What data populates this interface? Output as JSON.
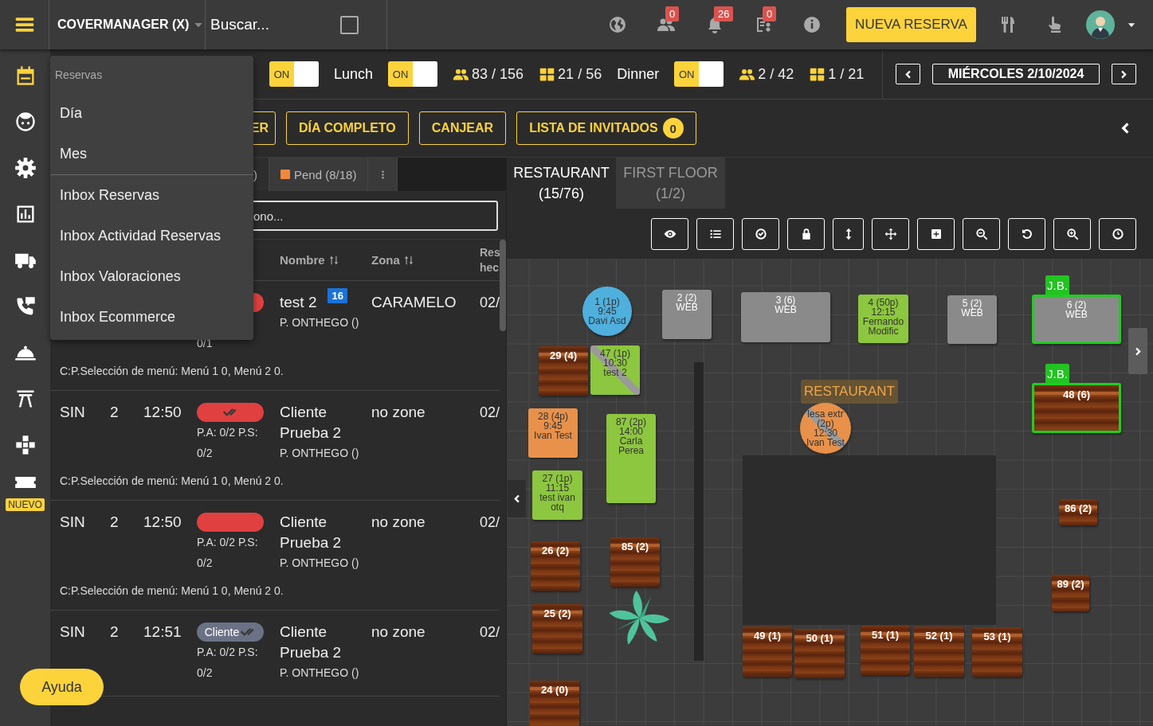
{
  "top_bar": {
    "restaurant": "COVERMANAGER (X)",
    "search": {
      "placeholder": "Buscar..."
    },
    "search_checkbox": {
      "checked": false
    },
    "indicators": [
      {
        "kind": "globe"
      },
      {
        "kind": "people",
        "badge": "0"
      },
      {
        "kind": "bell",
        "badge": "26"
      },
      {
        "kind": "clipboard",
        "badge": "0"
      },
      {
        "kind": "info"
      }
    ],
    "new_booking": "NUEVA RESERVA"
  },
  "sidebar": {
    "items": [
      {
        "kind": "calendar",
        "selected": true
      },
      {
        "kind": "face",
        "selected": false
      },
      {
        "kind": "gear",
        "selected": false
      },
      {
        "kind": "chart",
        "selected": false
      },
      {
        "kind": "truck",
        "selected": false
      },
      {
        "kind": "phone",
        "selected": false
      },
      {
        "kind": "cloche",
        "selected": false
      },
      {
        "kind": "gate",
        "selected": false
      },
      {
        "kind": "puzzle",
        "selected": false
      },
      {
        "kind": "ticket",
        "selected": false,
        "badge": "NUEVO"
      }
    ]
  },
  "menu": {
    "header": "Reservas",
    "groups": [
      [
        "Día",
        "Mes"
      ],
      [
        "Inbox Reservas",
        "Inbox Actividad Reservas",
        "Inbox Valoraciones",
        "Inbox Ecommerce"
      ]
    ]
  },
  "services": [
    {
      "on": true,
      "switch_label": "ON"
    },
    {
      "name": "Lunch",
      "on": true,
      "switch_label": "ON",
      "covers": "83 / 156",
      "tables": "21 / 56"
    },
    {
      "name": "Dinner",
      "on": true,
      "switch_label": "ON",
      "covers": "2 / 42",
      "tables": "1 / 21"
    }
  ],
  "date_nav": {
    "date": "MIÉRCOLES 2/10/2024"
  },
  "actions": [
    {
      "label": "ER"
    },
    {
      "label": "DÍA COMPLETO"
    },
    {
      "label": "CANJEAR"
    },
    {
      "label": "LISTA DE INVITADOS",
      "badge": "0"
    }
  ],
  "list": {
    "tabs": [
      {
        "label": ")",
        "selected": false
      },
      {
        "label": "Pend (8/18)",
        "color": "#f0883e",
        "selected": false
      }
    ],
    "search": {
      "placeholder": "ono..."
    },
    "columns": [
      "Nombre",
      "Zona",
      "Res hec"
    ],
    "rows": [
      {
        "status": {
          "color": "#e0403f"
        },
        "pa_ps": "0/1",
        "name": "test 2",
        "badge": "16",
        "origin": "P. ONTHEGO ()",
        "zone": "CARAMELO",
        "date": "02/",
        "note": "C:P.Selección de menú: Menú 1 0, Menú 2 0."
      },
      {
        "plan": "SIN",
        "pax": "2",
        "time": "12:50",
        "status": {
          "color": "#e0403f",
          "confirmed": true
        },
        "pa_ps": "P.A: 0/2 P.S: 0/2",
        "name": "Cliente Prueba 2",
        "origin": "P. ONTHEGO ()",
        "zone": "no zone",
        "date": "02/",
        "note": "C:P.Selección de menú: Menú 1 0, Menú 2 0."
      },
      {
        "plan": "SIN",
        "pax": "2",
        "time": "12:50",
        "status": {
          "color": "#e0403f",
          "confirmed": false
        },
        "pa_ps": "P.A: 0/2 P.S: 0/2",
        "name": "Cliente Prueba 2",
        "origin": "P. ONTHEGO ()",
        "zone": "no zone",
        "date": "02/",
        "note": "C:P.Selección de menú: Menú 1 0, Menú 2 0."
      },
      {
        "plan": "SIN",
        "pax": "2",
        "time": "12:51",
        "status": {
          "color": "#6b7285",
          "label": "Cliente",
          "confirmed": true
        },
        "pa_ps": "P.A: 0/2 P.S: 0/2",
        "name": "Cliente Prueba 2",
        "origin": "P. ONTHEGO ()",
        "zone": "no zone",
        "date": "02/"
      }
    ]
  },
  "floor": {
    "zones": [
      {
        "name": "RESTAURANT",
        "count": "(15/76)",
        "selected": true
      },
      {
        "name": "FIRST FLOOR",
        "count": "(1/2)",
        "selected": false
      }
    ],
    "tools": [
      {
        "kind": "eye"
      },
      {
        "kind": "list"
      },
      {
        "kind": "check"
      },
      {
        "kind": "lock"
      },
      {
        "kind": "resize"
      },
      {
        "kind": "move"
      },
      {
        "kind": "add"
      },
      {
        "kind": "zoom-out"
      },
      {
        "kind": "undo"
      },
      {
        "kind": "zoom-in"
      },
      {
        "kind": "clock"
      }
    ],
    "zone_label": "RESTAURANT",
    "tables": [
      {
        "kind": "round",
        "color": "#4fb0de",
        "struck": false,
        "lines": [
          "1 (1p)",
          "9:45",
          "Davi Asd"
        ]
      },
      {
        "kind": "plain",
        "color": "#8a8a8a",
        "struck": false,
        "lines": [
          "2 (2)",
          "WEB"
        ]
      },
      {
        "kind": "plain",
        "color": "#8a8a8a",
        "struck": false,
        "lines": [
          "3 (6)",
          "WEB"
        ]
      },
      {
        "kind": "plain",
        "color": "#8dc63f",
        "struck": false,
        "lines": [
          "4 (50p)",
          "12:15",
          "Fernando",
          "Modific"
        ]
      },
      {
        "kind": "plain",
        "color": "#8a8a8a",
        "struck": false,
        "lines": [
          "5 (2)",
          "WEB"
        ]
      },
      {
        "kind": "plain",
        "color": "#8a8a8a",
        "struck": false,
        "tag": "J.B.",
        "lines": [
          "6 (2)",
          "WEB"
        ]
      },
      {
        "kind": "wood",
        "struck": false,
        "lines": [
          "29 (4)"
        ]
      },
      {
        "kind": "plain",
        "color": "#8dc63f",
        "struck": true,
        "lines": [
          "47 (1p)",
          "10:30",
          "test 2"
        ]
      },
      {
        "kind": "wood",
        "struck": false,
        "tag": "J.B.",
        "lines": [
          "48 (6)"
        ]
      },
      {
        "kind": "plain",
        "color": "#e8914a",
        "struck": false,
        "lines": [
          "28 (4p)",
          "9:45",
          "Ivan Test"
        ]
      },
      {
        "kind": "plain",
        "color": "#8dc63f",
        "struck": false,
        "lines": [
          "87 (2p)",
          "14:00",
          "Carla",
          "Perea"
        ]
      },
      {
        "kind": "round",
        "color": "#e8914a",
        "struck": true,
        "lines": [
          "lesa extr",
          "(2p)",
          "12:30",
          "Ivan Test"
        ]
      },
      {
        "kind": "plain",
        "color": "#8dc63f",
        "struck": false,
        "lines": [
          "27 (1p)",
          "11:15",
          "test ivan",
          "otq"
        ]
      },
      {
        "kind": "wood",
        "struck": false,
        "lines": [
          "26 (2)"
        ]
      },
      {
        "kind": "wood",
        "struck": false,
        "lines": [
          "85 (2)"
        ]
      },
      {
        "kind": "wood",
        "struck": false,
        "lines": [
          "25 (2)"
        ]
      },
      {
        "kind": "wood",
        "struck": false,
        "lines": [
          "24 (0)"
        ]
      },
      {
        "kind": "wood",
        "struck": false,
        "lines": [
          "86 (2)"
        ]
      },
      {
        "kind": "wood",
        "struck": false,
        "lines": [
          "89 (2)"
        ]
      },
      {
        "kind": "wood",
        "struck": false,
        "lines": [
          "49 (1)"
        ]
      },
      {
        "kind": "wood",
        "struck": false,
        "lines": [
          "50 (1)"
        ]
      },
      {
        "kind": "wood",
        "struck": false,
        "lines": [
          "51 (1)"
        ]
      },
      {
        "kind": "wood",
        "struck": false,
        "lines": [
          "52 (1)"
        ]
      },
      {
        "kind": "wood",
        "struck": false,
        "lines": [
          "53 (1)"
        ]
      }
    ]
  },
  "help_button": "Ayuda"
}
